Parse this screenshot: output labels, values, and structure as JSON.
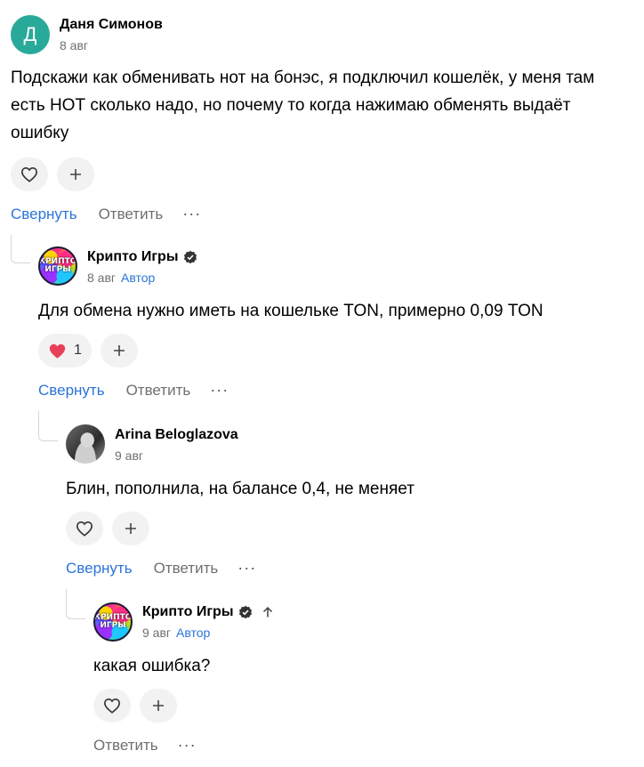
{
  "comments": [
    {
      "avatar_letter": "Д",
      "author": "Даня Симонов",
      "date": "8 авг",
      "text": "Подскажи как обменивать нот на бонэс, я подключил кошелёк, у меня там есть НОТ сколько надо, но почему то когда нажимаю обменять выдаёт ошибку",
      "actions": {
        "collapse": "Свернуть",
        "reply": "Ответить",
        "more": "···"
      }
    },
    {
      "avatar_text": "КРИПТО ИГРЫ",
      "author": "Крипто Игры",
      "date": "8 авг",
      "badge": "Автор",
      "text": "Для обмена нужно иметь на кошельке TON, примерно 0,09 TON",
      "likes": "1",
      "actions": {
        "collapse": "Свернуть",
        "reply": "Ответить",
        "more": "···"
      }
    },
    {
      "author": "Arina Beloglazova",
      "date": "9 авг",
      "text": "Блин, пополнила, на балансе 0,4, не меняет",
      "actions": {
        "collapse": "Свернуть",
        "reply": "Ответить",
        "more": "···"
      }
    },
    {
      "avatar_text": "КРИПТО ИГРЫ",
      "author": "Крипто Игры",
      "date": "9 авг",
      "badge": "Автор",
      "text": "какая ошибка?",
      "actions": {
        "reply": "Ответить",
        "more": "···"
      }
    }
  ],
  "colors": {
    "link_blue": "#2b74d8",
    "muted_gray": "#6f6f6f",
    "pill_bg": "#f2f2f2",
    "heart_red": "#e8405a",
    "avatar_teal": "#29a999"
  },
  "icons": [
    "heart-icon",
    "plus-icon",
    "verified-icon",
    "arrow-up-icon",
    "more-icon"
  ]
}
